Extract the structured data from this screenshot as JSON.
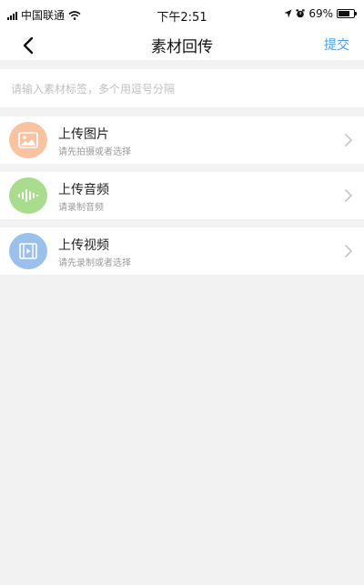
{
  "status_bar": {
    "carrier": "中国联通",
    "time": "下午2:51",
    "battery_percent": "69%",
    "battery_level": 0.69
  },
  "nav": {
    "title": "素材回传",
    "submit_label": "提交"
  },
  "tag_input": {
    "placeholder": "请输入素材标签，多个用逗号分隔",
    "value": ""
  },
  "upload_items": [
    {
      "title": "上传图片",
      "subtitle": "请先拍摄或者选择",
      "icon": "image-icon",
      "color": "#f7c3a1"
    },
    {
      "title": "上传音频",
      "subtitle": "请录制音频",
      "icon": "audio-wave-icon",
      "color": "#a9dc8f"
    },
    {
      "title": "上传视频",
      "subtitle": "请先录制或者选择",
      "icon": "video-icon",
      "color": "#9bc0ec"
    }
  ]
}
